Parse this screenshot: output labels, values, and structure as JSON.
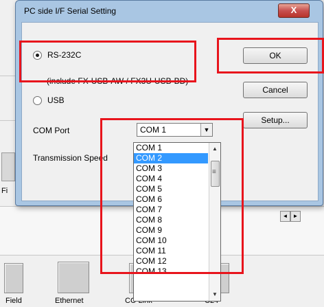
{
  "background": {
    "fragment_label": "Fi",
    "bottom_labels": [
      "Field",
      "Ethernet",
      "CC-Link",
      "C24"
    ]
  },
  "dialog": {
    "title": "PC side I/F Serial Setting",
    "close_glyph": "X",
    "rs232c_label": "RS-232C",
    "rs232c_note": "(include FX-USB-AW / FX3U-USB-BD)",
    "usb_label": "USB",
    "com_port_label": "COM Port",
    "transmission_speed_label": "Transmission Speed",
    "ok_label": "OK",
    "cancel_label": "Cancel",
    "setup_label": "Setup...",
    "com_port_value": "COM 1"
  },
  "dropdown": {
    "items": [
      "COM 1",
      "COM 2",
      "COM 3",
      "COM 4",
      "COM 5",
      "COM 6",
      "COM 7",
      "COM 8",
      "COM 9",
      "COM 10",
      "COM 11",
      "COM 12",
      "COM 13"
    ],
    "selected": "COM 2"
  },
  "colors": {
    "annotation": "#e8141c",
    "selection": "#3399ff",
    "title_bar": "#a9c6e3",
    "close_button": "#c75050"
  }
}
